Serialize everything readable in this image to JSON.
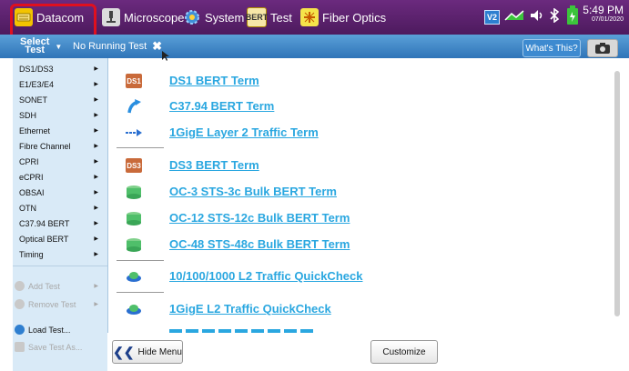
{
  "top_bar": {
    "apps": [
      {
        "label": "Datacom",
        "icon": "keyboard-icon"
      },
      {
        "label": "Microscope",
        "icon": "microscope-icon"
      },
      {
        "label": "System",
        "icon": "gear-icon"
      },
      {
        "label": "Test",
        "icon": "bert-icon",
        "icon_text": "BERT"
      },
      {
        "label": "Fiber Optics",
        "icon": "fiber-optics-icon"
      }
    ],
    "status": {
      "badge": "V2",
      "time": "5:49 PM",
      "date": "07/01/2020"
    }
  },
  "sub_bar": {
    "select_test_line1": "Select",
    "select_test_line2": "Test",
    "running_test": "No Running Test",
    "whats_this": "What's This?"
  },
  "sidebar": {
    "items": [
      {
        "label": "DS1/DS3"
      },
      {
        "label": "E1/E3/E4"
      },
      {
        "label": "SONET"
      },
      {
        "label": "SDH"
      },
      {
        "label": "Ethernet"
      },
      {
        "label": "Fibre Channel"
      },
      {
        "label": "CPRI"
      },
      {
        "label": "eCPRI"
      },
      {
        "label": "OBSAI"
      },
      {
        "label": "OTN"
      },
      {
        "label": "C37.94 BERT"
      },
      {
        "label": "Optical BERT"
      },
      {
        "label": "Timing"
      }
    ],
    "actions": [
      {
        "label": "Add Test",
        "enabled": false
      },
      {
        "label": "Remove Test",
        "enabled": false
      },
      {
        "label": "Load Test...",
        "enabled": true
      },
      {
        "label": "Save Test As...",
        "enabled": false
      }
    ]
  },
  "tests": [
    {
      "label": "DS1 BERT Term",
      "icon": "ds1-icon",
      "icon_text": "DS1"
    },
    {
      "label": "C37.94 BERT Term",
      "icon": "arrow-icon"
    },
    {
      "label": "1GigE Layer 2 Traffic Term",
      "icon": "traffic-arrow-icon"
    },
    {
      "label": "DS3 BERT Term",
      "icon": "ds3-icon",
      "icon_text": "DS3"
    },
    {
      "label": "OC-3 STS-3c Bulk BERT Term",
      "icon": "sonet-icon"
    },
    {
      "label": "OC-12 STS-12c Bulk BERT Term",
      "icon": "sonet-icon"
    },
    {
      "label": "OC-48 STS-48c Bulk BERT Term",
      "icon": "sonet-icon"
    },
    {
      "label": "10/100/1000 L2 Traffic QuickCheck",
      "icon": "quickcheck-icon"
    },
    {
      "label": "1GigE L2 Traffic QuickCheck",
      "icon": "quickcheck-icon"
    }
  ],
  "buttons": {
    "hide_menu": "Hide Menu",
    "customize": "Customize"
  },
  "colors": {
    "top_bar": "#5a2070",
    "sub_bar": "#3a86c8",
    "link": "#2aa7e0",
    "sidebar": "#d9eaf7",
    "highlight": "#e0101e"
  }
}
